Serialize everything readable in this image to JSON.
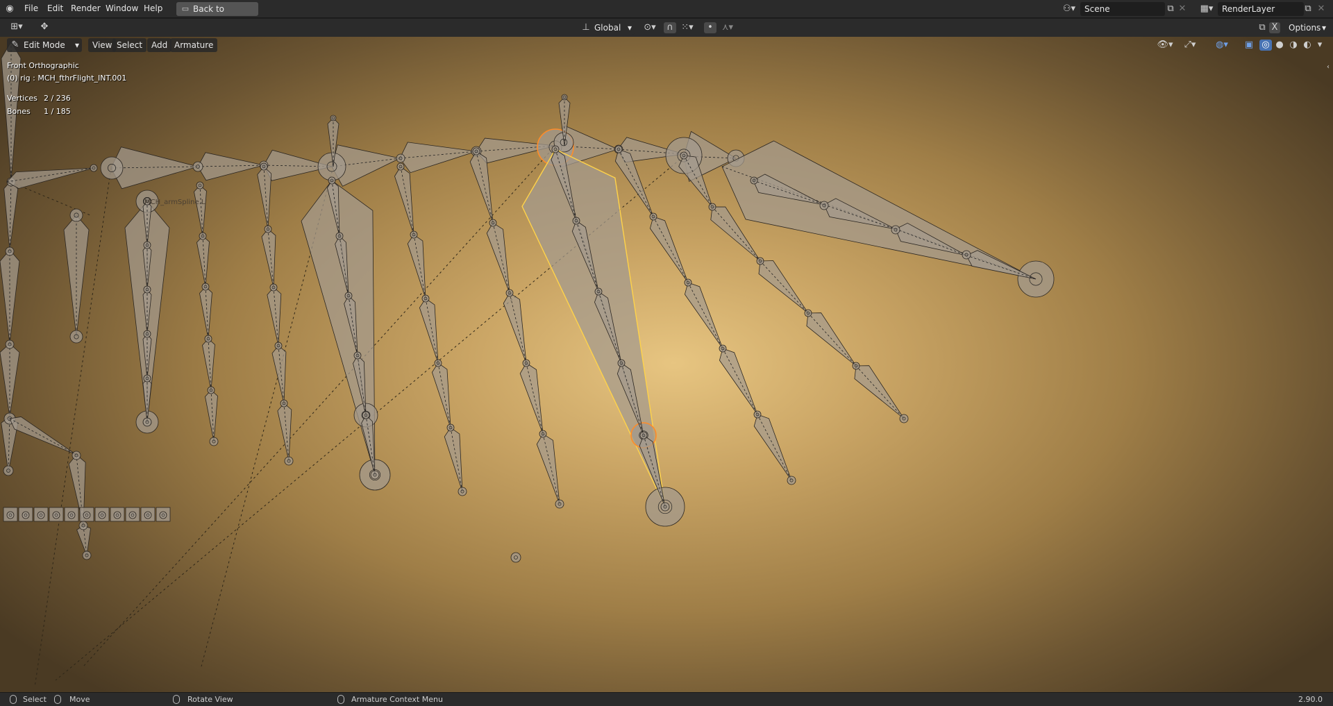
{
  "topbar": {
    "menus": [
      "File",
      "Edit",
      "Render",
      "Window",
      "Help"
    ],
    "back_button": "Back to Previous",
    "scene_value": "Scene",
    "render_layer_value": "RenderLayer"
  },
  "toolheader": {
    "orientation_value": "Global",
    "options_label": "Options"
  },
  "viewport_header": {
    "mode_value": "Edit Mode",
    "menus": [
      "View",
      "Select",
      "Add",
      "Armature"
    ]
  },
  "overlay": {
    "view_name": "Front Orthographic",
    "object_info": "(0) rig : MCH_fthrFlight_INT.001",
    "stats": [
      {
        "label": "Vertices",
        "value": "2 / 236"
      },
      {
        "label": "Bones",
        "value": "1 / 185"
      }
    ],
    "bone_label": "MCH_armSpline.L"
  },
  "statusbar": {
    "items": [
      "Select",
      "Move",
      "Rotate View",
      "Armature Context Menu"
    ],
    "version": "2.90.0"
  },
  "colors": {
    "accent_blue": "#4772b3",
    "selection_orange": "#ff8c28",
    "selection_yellow": "#ffd34a",
    "bone_fill": "#a39a8e"
  },
  "icons": [
    "blender-logo-icon",
    "editor-type-icon",
    "move-tool-icon",
    "scene-icon",
    "render-layer-icon",
    "pivot-icon",
    "snap-icon",
    "proportional-icon",
    "visibility-icon",
    "gizmo-icon",
    "overlay-icon",
    "xray-icon",
    "wireframe-shading-icon",
    "solid-shading-icon",
    "material-shading-icon",
    "rendered-shading-icon",
    "sidebar-toggle-icon"
  ]
}
